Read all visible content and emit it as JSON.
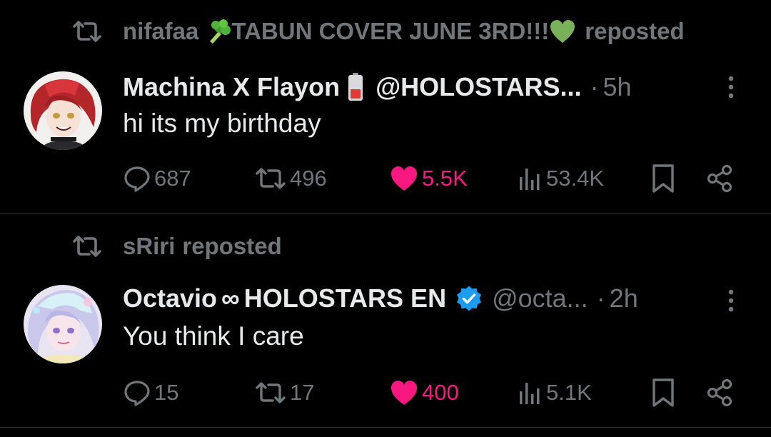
{
  "colors": {
    "background": "#000000",
    "text_primary": "#e7e9ea",
    "text_secondary": "#71767b",
    "like_active": "#f91880",
    "verified": "#1d9bf0",
    "divider": "#2f3336"
  },
  "posts": [
    {
      "repost": {
        "user": "nifafaa",
        "user_suffix": "TABUN COVER JUNE 3RD!!!",
        "label": "reposted"
      },
      "author": {
        "display_name": "Machina X Flayon",
        "handle": "@HOLOSTARS...",
        "verified": false
      },
      "dot": "·",
      "time": "5h",
      "text": "hi its my birthday",
      "stats": {
        "replies": "687",
        "reposts": "496",
        "likes": "5.5K",
        "views": "53.4K"
      },
      "liked": true
    },
    {
      "repost": {
        "user": "sRiri",
        "label": "reposted"
      },
      "author": {
        "display_name_part1": "Octavio",
        "infinity": "∞",
        "display_name_part2": "HOLOSTARS EN",
        "handle": "@octa...",
        "verified": true
      },
      "dot": "·",
      "time": "2h",
      "text": "You think I care",
      "stats": {
        "replies": "15",
        "reposts": "17",
        "likes": "400",
        "views": "5.1K"
      },
      "liked": true
    }
  ]
}
